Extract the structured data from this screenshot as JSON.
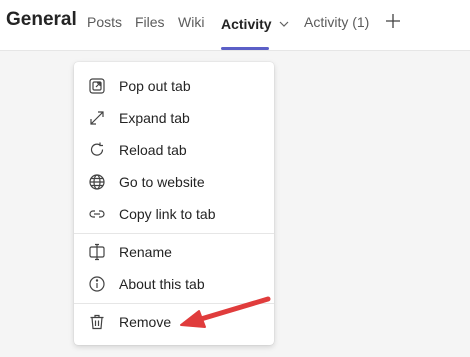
{
  "header": {
    "channel_title": "General",
    "tabs": [
      {
        "label": "Posts"
      },
      {
        "label": "Files"
      },
      {
        "label": "Wiki"
      },
      {
        "label": "Activity"
      },
      {
        "label": "Activity (1)"
      }
    ],
    "active_tab_index": 3,
    "accent_color": "#5b5fc7",
    "add_icon": "plus-icon",
    "active_tab_icon": "chevron-down-icon"
  },
  "context_menu": {
    "items": [
      {
        "label": "Pop out tab",
        "icon": "pop-out-icon"
      },
      {
        "label": "Expand tab",
        "icon": "expand-icon"
      },
      {
        "label": "Reload tab",
        "icon": "reload-icon"
      },
      {
        "label": "Go to website",
        "icon": "globe-icon"
      },
      {
        "label": "Copy link to tab",
        "icon": "link-icon"
      },
      {
        "label": "Rename",
        "icon": "rename-icon"
      },
      {
        "label": "About this tab",
        "icon": "info-icon"
      },
      {
        "label": "Remove",
        "icon": "trash-icon"
      }
    ]
  },
  "annotation": {
    "arrow_color": "#e03c3c",
    "arrow_icon": "red-arrow-pointing-left"
  }
}
